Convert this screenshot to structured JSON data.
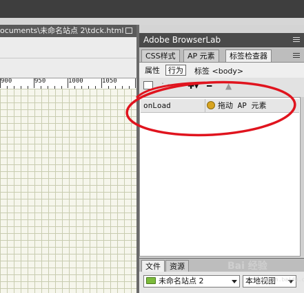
{
  "document": {
    "tab_title": "ocuments\\未命名站点 2\\tdck.html"
  },
  "ruler": {
    "labels": [
      "900",
      "950",
      "1000",
      "1050"
    ]
  },
  "panel": {
    "header_title": "Adobe BrowserLab",
    "tabs": [
      "CSS样式",
      "AP 元素",
      "标签检查器"
    ],
    "active_tab": "标签检查器",
    "sub_buttons": [
      "属性",
      "行为"
    ],
    "active_sub": "行为",
    "tag_label": "标签 <body>"
  },
  "behaviors": {
    "rows": [
      {
        "event": "onLoad",
        "action": "拖动 AP 元素",
        "icon": "gear-icon"
      }
    ]
  },
  "files": {
    "tabs": [
      "文件",
      "资源"
    ],
    "site_select": "未命名站点 2",
    "view_select": "本地视图"
  },
  "watermark": {
    "text": "Bai 经验",
    "sub": "jingyan.baidu.com"
  },
  "colors": {
    "annotation": "#e0141e",
    "panel_header": "#4a4a4a",
    "grid_line": "#c8ccb0"
  }
}
